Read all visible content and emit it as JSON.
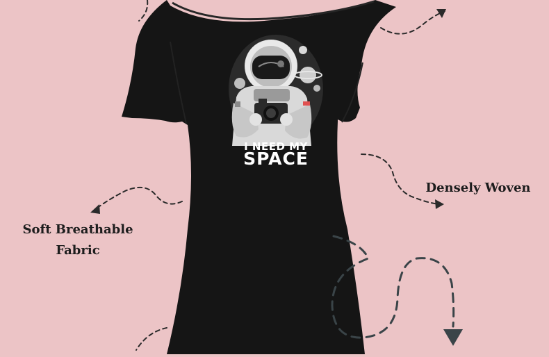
{
  "colors": {
    "background": "#ecc4c6",
    "shirt": "#151515",
    "print_white": "#ffffff",
    "arrow": "#2a2a2a",
    "arrow_large": "#3a4448"
  },
  "labels": {
    "soft_line1": "Soft Breathable",
    "soft_line2": "Fabric",
    "dense": "Densely Woven"
  },
  "shirt_print": {
    "line1": "I NEED MY",
    "line2": "SPACE",
    "illustration": "astronaut-with-camera"
  },
  "icons": [
    "dashed-arrow",
    "large-dashed-curved-arrow"
  ]
}
